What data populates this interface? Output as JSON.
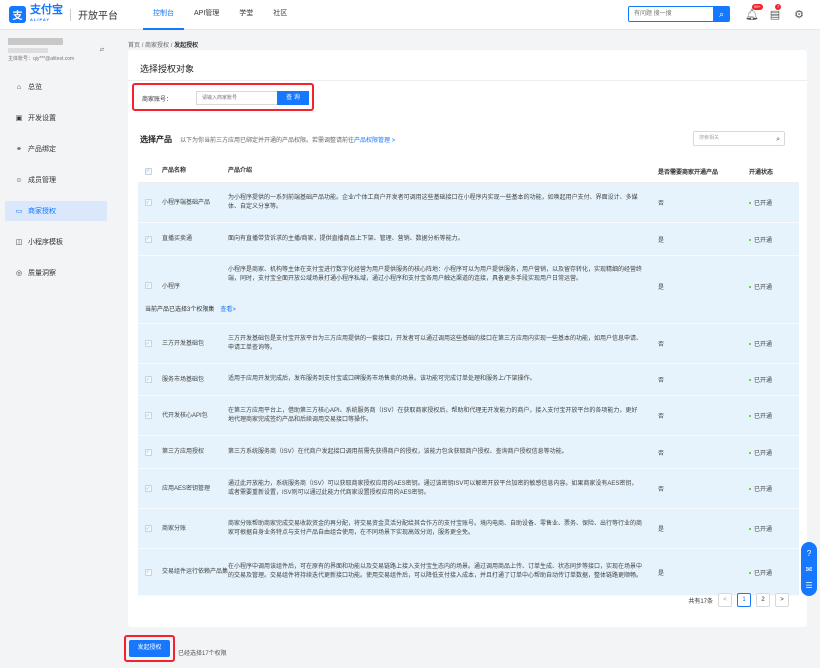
{
  "header": {
    "logo_mark": "支",
    "logo_text": "支付宝",
    "logo_sub": "ALIPAY",
    "platform": "开放平台",
    "nav": [
      {
        "label": "控制台",
        "active": true
      },
      {
        "label": "API管理"
      },
      {
        "label": "学堂"
      },
      {
        "label": "社区"
      }
    ],
    "search_placeholder": "有问题 搜一搜",
    "notify_badge": "99+",
    "task_badge": "7"
  },
  "sidebar": {
    "account_id_label": "主体账号：qiy***@alitest.com",
    "items": [
      {
        "label": "总览",
        "icon": "home-icon"
      },
      {
        "label": "开发设置",
        "icon": "code-icon"
      },
      {
        "label": "产品绑定",
        "icon": "link-icon"
      },
      {
        "label": "成员管理",
        "icon": "members-icon"
      },
      {
        "label": "商家授权",
        "icon": "auth-icon",
        "active": true
      },
      {
        "label": "小程序模板",
        "icon": "template-icon"
      },
      {
        "label": "质量洞察",
        "icon": "quality-icon"
      }
    ]
  },
  "breadcrumb": {
    "home": "首页",
    "parent": "商家授权",
    "current": "发起授权",
    "sep": "/"
  },
  "auth_card": {
    "title": "选择授权对象",
    "label": "商家账号：",
    "placeholder": "请输入商家账号",
    "button": "查 询"
  },
  "product_card": {
    "title": "选择产品",
    "desc_pre": "以下为你当前三方应用已绑定并开通的产品权限。若需调整请前往",
    "desc_link": "产品权限管理 >",
    "search_placeholder": "搜索相关",
    "headers": {
      "name": "产品名称",
      "intro": "产品介绍",
      "need": "是否需要商家开通产品",
      "status": "开通状态"
    },
    "rows": [
      {
        "name": "小程序端基础产品",
        "intro": "为小程序提供的一系列前端基础产品功能。企业/个体工商户开发者可调用这些基础接口在小程序内实现一些基本的功能，如唤起用户支付、界面设计、多媒体、自定义分享等。",
        "need": "否",
        "status": "已开通"
      },
      {
        "name": "直播买卖通",
        "intro": "面向有直播带货诉求的主播/商家，提供直播商品上下架、管理、营销、数据分析等能力。",
        "need": "是",
        "status": "已开通"
      },
      {
        "name": "小程序",
        "intro": "小程序是商家、机构等主体在支付宝进行数字化经营为用户提供服务的核心阵地：小程序可以为用户提供服务，用户营销，以及留存转化，实现精细的经营终端，同时，支付宝全面开放公域场景打通小程序私域，通过小程序和支付宝各用户触达渠道的连接，具备更多手段实现用户日常运营。",
        "need": "是",
        "status": "已开通"
      },
      {
        "name": "三方开发基础包",
        "intro": "三方开发基础包是支付宝开放平台为三方应用提供的一套接口，开发者可以通过调用这些基础的接口在第三方应用内实现一些基本的功能，如用户信息申请、申请工单查询等。",
        "need": "否",
        "status": "已开通"
      },
      {
        "name": "服务市场基础包",
        "intro": "适用于应用开发完成后，发布服务到支付宝或口碑服务市场售卖的场景。该功能可完成订单处理和服务上/下架操作。",
        "need": "否",
        "status": "已开通"
      },
      {
        "name": "代开发核心API包",
        "intro": "在第三方应用平台上，借助第三方核心API、系统服务商（ISV）在获取商家授权后，帮助和代理无开发能力的商户，接入支付宝开放平台的各项能力，更好地代理商家完成签约产品和后续调用交易接口等操作。",
        "need": "否",
        "status": "已开通"
      },
      {
        "name": "第三方应用授权",
        "intro": "第三方系统服务商（ISV）在代商户发起接口调用前需先获得商户的授权，该能力包含获取商户授权、查询商户授权信息等功能。",
        "need": "否",
        "status": "已开通"
      },
      {
        "name": "应用AES密钥管理",
        "intro": "通过此开放能力，系统服务商（ISV）可以获取商家授权应用的AES密钥。通过该密钥ISV可以解密开放平台加密的敏感信息内容。如果商家没有AES密钥，或者需要重新设置，ISV则可以通过此能力代商家设置授权应用的AES密钥。",
        "need": "否",
        "status": "已开通"
      },
      {
        "name": "商家分账",
        "intro": "商家分账帮助商家完成交易收款资金的再分配，将交易资金灵活分配给其合作方的支付宝账号。境内电商、自助设备、零售业、票务、保险、出行等行业的商家可根据自身业务特点与支付产品自由组合使用，在不同场景下实现高效分润，服务更全免。",
        "need": "是",
        "status": "已开通"
      },
      {
        "name": "交易组件运行依赖产品集",
        "intro": "在小程序中调用该组件后，可在原有的界面和功能以及交易链路上接入支付宝生态内的场景。通过调用商品上传、订单生成、状态同步等接口，实现在场景中的交易及管理。交易组件将持续迭代更新接口功能。使用交易组件后，可以降低支付接入成本，并且打通了订单中心帮助自动传订单数据，整体链路更顺畅。",
        "need": "是",
        "status": "已开通"
      }
    ],
    "selected_note": "当前产品已选择3个权限集",
    "selected_link": "查看>",
    "pager": {
      "total": "共有17条",
      "pages": [
        "1",
        "2"
      ],
      "prev": "<",
      "next": ">"
    }
  },
  "footer": {
    "submit": "发起授权",
    "note": "已经选择17个权限"
  }
}
